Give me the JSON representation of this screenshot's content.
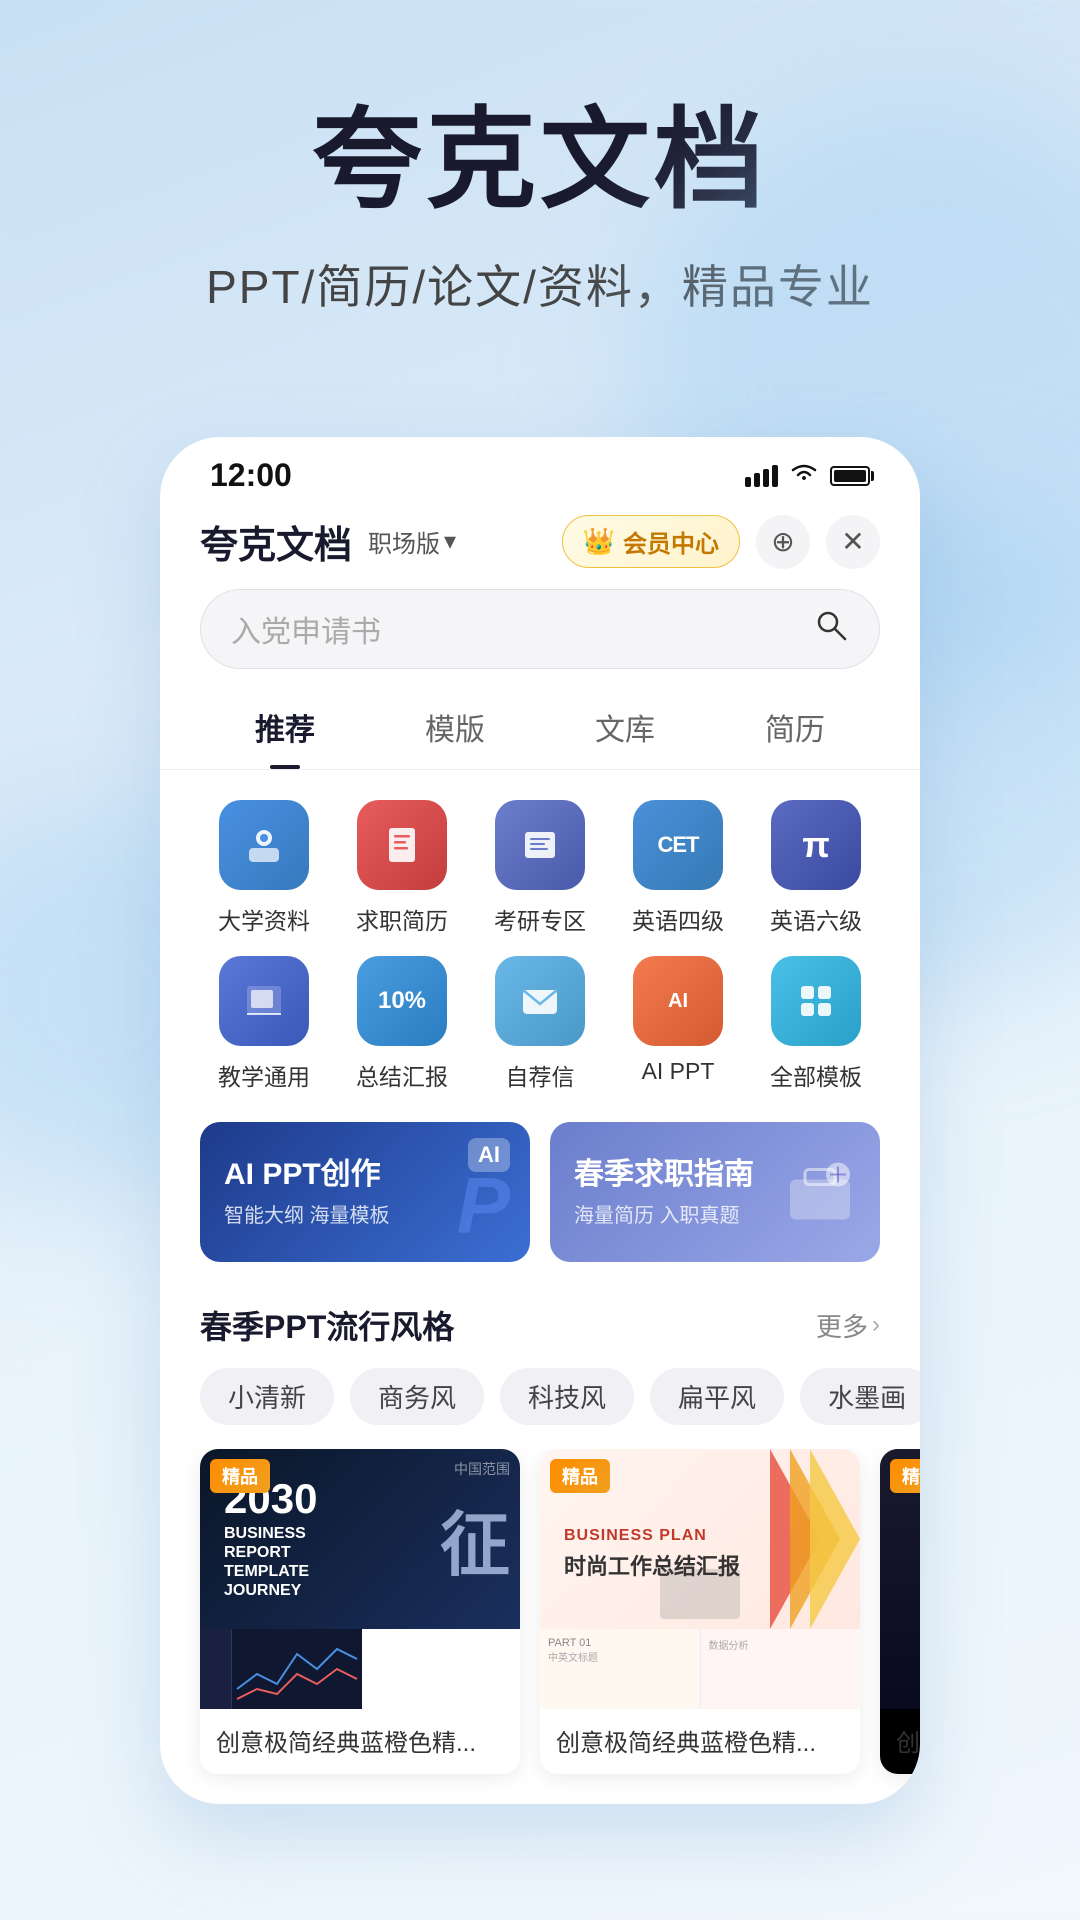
{
  "hero": {
    "title": "夸克文档",
    "subtitle": "PPT/简历/论文/资料，精品专业"
  },
  "status_bar": {
    "time": "12:00",
    "signal_bars": 4,
    "wifi": "wifi",
    "battery": "full"
  },
  "app_header": {
    "logo": "夸克文档",
    "version_label": "职场版",
    "vip_label": "会员中心",
    "add_icon": "+",
    "close_icon": "×"
  },
  "search": {
    "placeholder": "入党申请书",
    "icon": "🔍"
  },
  "tabs": [
    {
      "label": "推荐",
      "active": true
    },
    {
      "label": "模版",
      "active": false
    },
    {
      "label": "文库",
      "active": false
    },
    {
      "label": "简历",
      "active": false
    }
  ],
  "icons": [
    {
      "label": "大学资料",
      "color_from": "#4a90e2",
      "color_to": "#357abd",
      "emoji": "🎓"
    },
    {
      "label": "求职简历",
      "color_from": "#e85d5d",
      "color_to": "#c43c3c",
      "emoji": "📄"
    },
    {
      "label": "考研专区",
      "color_from": "#6b7ecc",
      "color_to": "#4a5aaa",
      "emoji": "📚"
    },
    {
      "label": "英语四级",
      "color_from": "#4a90d9",
      "color_to": "#357ab5",
      "emoji": "CET"
    },
    {
      "label": "英语六级",
      "color_from": "#5b6bc2",
      "color_to": "#3a4aa0",
      "emoji": "π"
    },
    {
      "label": "教学通用",
      "color_from": "#5a78d8",
      "color_to": "#3a58b8",
      "emoji": "📝"
    },
    {
      "label": "总结汇报",
      "color_from": "#4a9de0",
      "color_to": "#2a7dc0",
      "emoji": "10%"
    },
    {
      "label": "自荐信",
      "color_from": "#6ab8e8",
      "color_to": "#4a98c8",
      "emoji": "✉️"
    },
    {
      "label": "AI PPT",
      "color_from": "#f47b50",
      "color_to": "#d45a30",
      "emoji": "AI"
    },
    {
      "label": "全部模板",
      "color_from": "#48c0e8",
      "color_to": "#28a0c8",
      "emoji": "⊞"
    }
  ],
  "banners": [
    {
      "title": "AI PPT创作",
      "subtitle": "智能大纲 海量模板",
      "type": "left",
      "tag": "AI"
    },
    {
      "title": "春季求职指南",
      "subtitle": "海量简历 入职真题",
      "type": "right"
    }
  ],
  "trending": {
    "section_title": "春季PPT流行风格",
    "more_label": "更多",
    "tags": [
      "小清新",
      "商务风",
      "科技风",
      "扁平风",
      "水墨画"
    ]
  },
  "templates": [
    {
      "badge": "精品",
      "name": "创意极简经典蓝橙色精...",
      "card_type": "business2030"
    },
    {
      "badge": "精品",
      "name": "创意极简经典蓝橙色精...",
      "card_type": "businessplan"
    },
    {
      "badge": "精",
      "name": "创",
      "card_type": "dark"
    }
  ],
  "colors": {
    "accent_blue": "#4a90e2",
    "accent_orange": "#f47b50",
    "dark_bg": "#0a1628",
    "badge_gold": "#f0a020"
  }
}
